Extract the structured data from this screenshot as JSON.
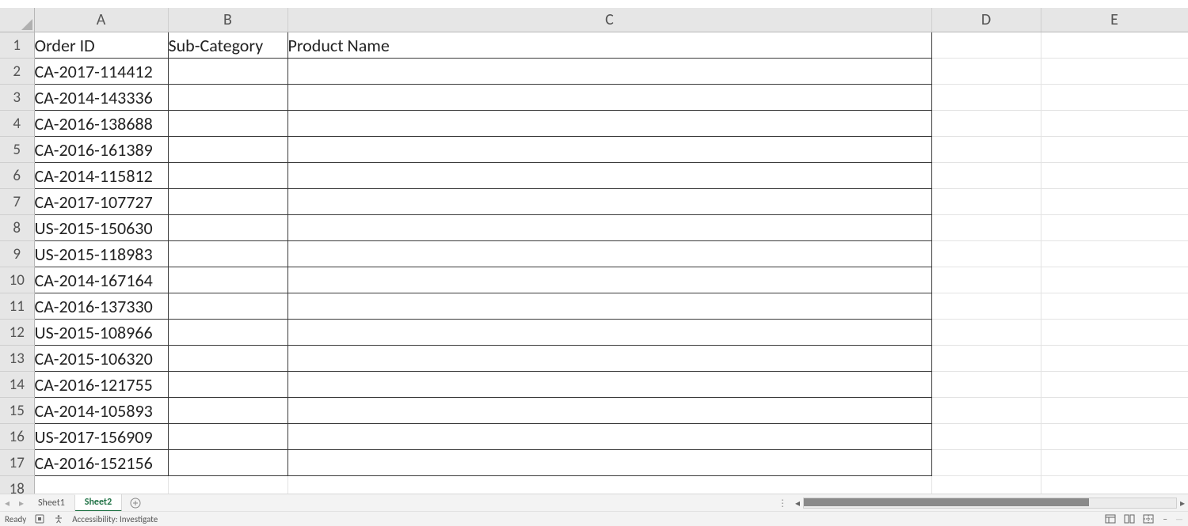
{
  "columns": [
    "A",
    "B",
    "C",
    "D",
    "E"
  ],
  "row_numbers": [
    1,
    2,
    3,
    4,
    5,
    6,
    7,
    8,
    9,
    10,
    11,
    12,
    13,
    14,
    15,
    16,
    17,
    18
  ],
  "headers": {
    "A": "Order ID",
    "B": "Sub-Category",
    "C": "Product Name"
  },
  "rows": [
    {
      "A": "CA-2017-114412",
      "B": "",
      "C": ""
    },
    {
      "A": "CA-2014-143336",
      "B": "",
      "C": ""
    },
    {
      "A": "CA-2016-138688",
      "B": "",
      "C": ""
    },
    {
      "A": "CA-2016-161389",
      "B": "",
      "C": ""
    },
    {
      "A": "CA-2014-115812",
      "B": "",
      "C": ""
    },
    {
      "A": "CA-2017-107727",
      "B": "",
      "C": ""
    },
    {
      "A": "US-2015-150630",
      "B": "",
      "C": ""
    },
    {
      "A": "US-2015-118983",
      "B": "",
      "C": ""
    },
    {
      "A": "CA-2014-167164",
      "B": "",
      "C": ""
    },
    {
      "A": "CA-2016-137330",
      "B": "",
      "C": ""
    },
    {
      "A": "US-2015-108966",
      "B": "",
      "C": ""
    },
    {
      "A": "CA-2015-106320",
      "B": "",
      "C": ""
    },
    {
      "A": "CA-2016-121755",
      "B": "",
      "C": ""
    },
    {
      "A": "CA-2014-105893",
      "B": "",
      "C": ""
    },
    {
      "A": "US-2017-156909",
      "B": "",
      "C": ""
    },
    {
      "A": "CA-2016-152156",
      "B": "",
      "C": ""
    }
  ],
  "data_region": {
    "rows": 17,
    "cols": 3
  },
  "sheets": [
    {
      "name": "Sheet1",
      "active": false
    },
    {
      "name": "Sheet2",
      "active": true
    }
  ],
  "status": {
    "ready": "Ready",
    "accessibility": "Accessibility: Investigate"
  },
  "zoom": {
    "minus": "−",
    "plus": "+"
  },
  "colors": {
    "excel_green": "#217346"
  }
}
